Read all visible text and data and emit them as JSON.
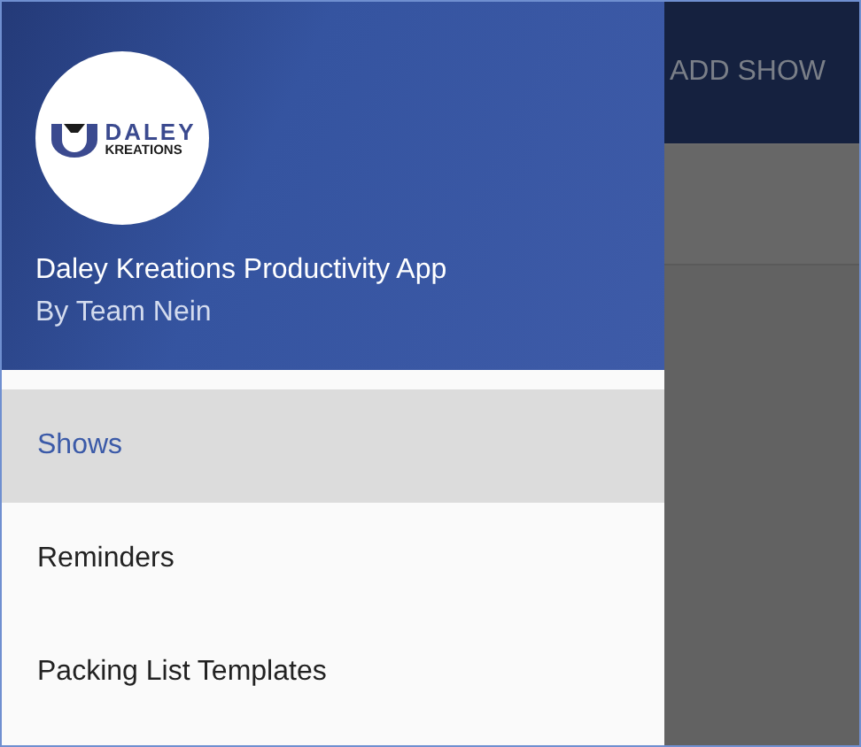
{
  "drawer": {
    "logo": {
      "line1": "DALEY",
      "line2": "KREATIONS"
    },
    "title": "Daley Kreations Productivity App",
    "subtitle": "By Team Nein",
    "items": [
      {
        "label": "Shows",
        "selected": true
      },
      {
        "label": "Reminders",
        "selected": false
      },
      {
        "label": "Packing List Templates",
        "selected": false
      }
    ]
  },
  "app_bar": {
    "action": "ADD SHOW"
  }
}
